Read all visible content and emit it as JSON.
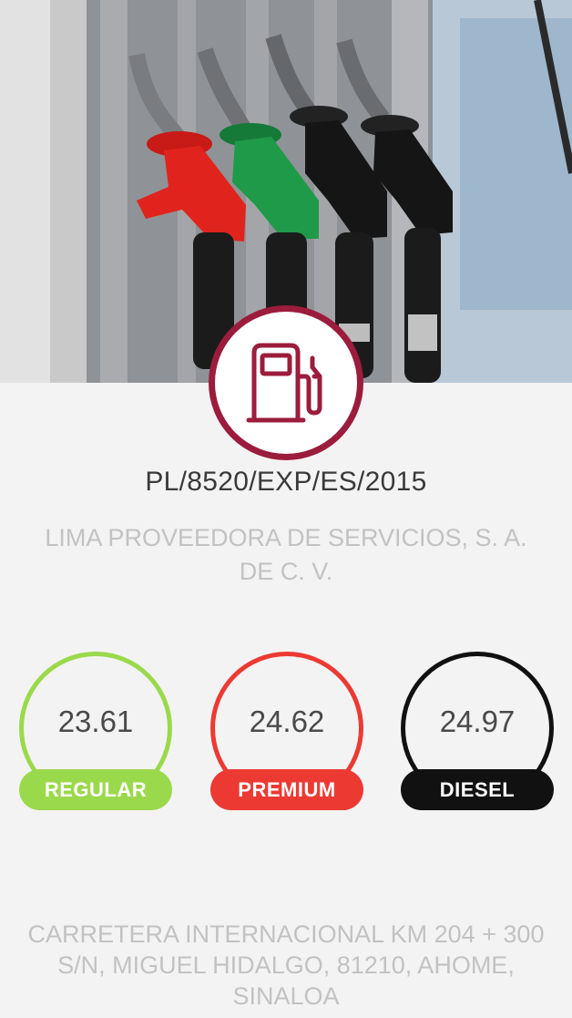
{
  "station": {
    "permit": "PL/8520/EXP/ES/2015",
    "company": "LIMA PROVEEDORA DE SERVICIOS, S. A. DE C. V.",
    "address": "CARRETERA INTERNACIONAL KM 204 + 300 S/N, MIGUEL HIDALGO, 81210, AHOME, SINALOA",
    "icon": "fuel-pump-icon",
    "accent_color": "#9b1c3c"
  },
  "hero": {
    "image": "fuel-nozzles-photo",
    "nozzle_colors": [
      "#e0241d",
      "#1f9a49",
      "#151515",
      "#151515"
    ]
  },
  "prices": [
    {
      "key": "regular",
      "value": "23.61",
      "label": "REGULAR",
      "color": "#9bd94c"
    },
    {
      "key": "premium",
      "value": "24.62",
      "label": "PREMIUM",
      "color": "#ec3a33"
    },
    {
      "key": "diesel",
      "value": "24.97",
      "label": "DIESEL",
      "color": "#111111"
    }
  ]
}
